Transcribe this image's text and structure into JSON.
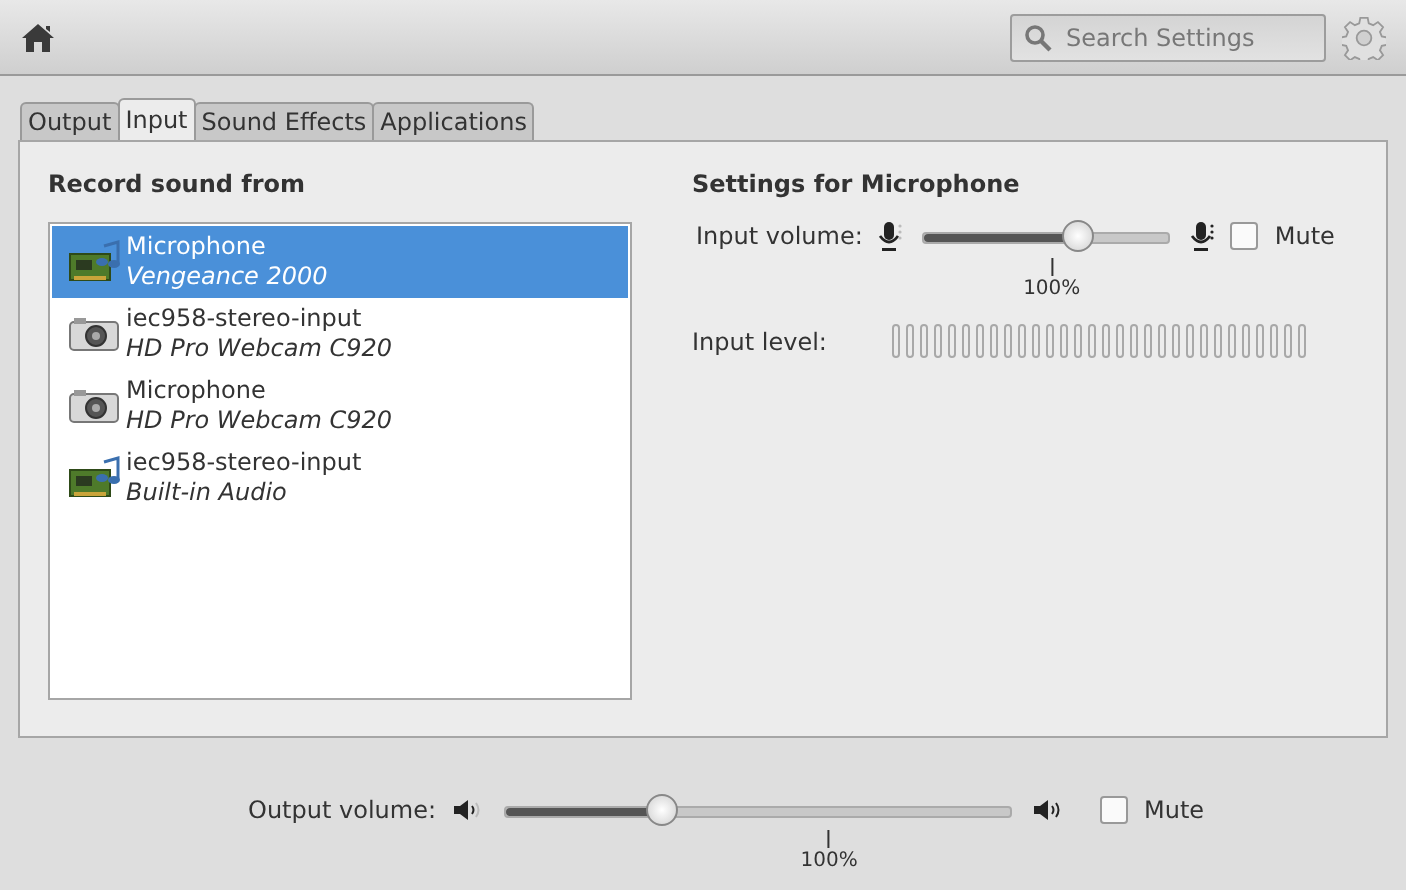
{
  "toolbar": {
    "search": {
      "placeholder": "Search Settings"
    }
  },
  "tabs": [
    {
      "label": "Output",
      "selected": false
    },
    {
      "label": "Input",
      "selected": true
    },
    {
      "label": "Sound Effects",
      "selected": false
    },
    {
      "label": "Applications",
      "selected": false
    }
  ],
  "devices": {
    "heading": "Record sound from",
    "items": [
      {
        "name": "Microphone",
        "description": "Vengeance 2000",
        "kind": "card",
        "selected": true
      },
      {
        "name": "iec958-stereo-input",
        "description": "HD Pro Webcam C920",
        "kind": "webcam",
        "selected": false
      },
      {
        "name": "Microphone",
        "description": "HD Pro Webcam C920",
        "kind": "webcam",
        "selected": false
      },
      {
        "name": "iec958-stereo-input",
        "description": "Built-in Audio",
        "kind": "card",
        "selected": false
      }
    ]
  },
  "settings": {
    "heading": "Settings for Microphone",
    "input_volume": {
      "label": "Input volume:",
      "level": 0.63,
      "mark": "100%",
      "mute": {
        "label": "Mute",
        "checked": false
      }
    },
    "input_level": {
      "label": "Input level:"
    }
  },
  "output_volume": {
    "label": "Output volume:",
    "level": 0.31,
    "mark": "100%",
    "mute": {
      "label": "Mute",
      "checked": false
    }
  }
}
